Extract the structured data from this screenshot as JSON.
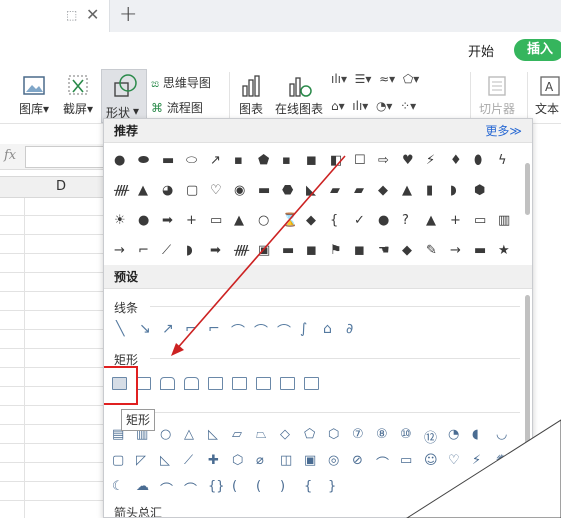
{
  "menu": {
    "start": "开始",
    "insert": "插入"
  },
  "ribbon": {
    "gallery": "图库",
    "screenshot": "截屏",
    "shapes": "形状",
    "mindmap": "思维导图",
    "flowchart": "流程图",
    "chart": "图表",
    "online_chart": "在线图表",
    "slicer": "切片器",
    "textbox": "文本"
  },
  "formula": {
    "fx": "fx"
  },
  "sheet": {
    "col_d": "D"
  },
  "panel": {
    "recommend": "推荐",
    "more": "更多≫",
    "preset": "预设",
    "lines": "线条",
    "rect": "矩形",
    "arrows": "箭头总汇",
    "tooltip": "矩形"
  },
  "colors": {
    "accent": "#35b55d",
    "selection": "#e02020",
    "arrow": "#cc2222"
  }
}
